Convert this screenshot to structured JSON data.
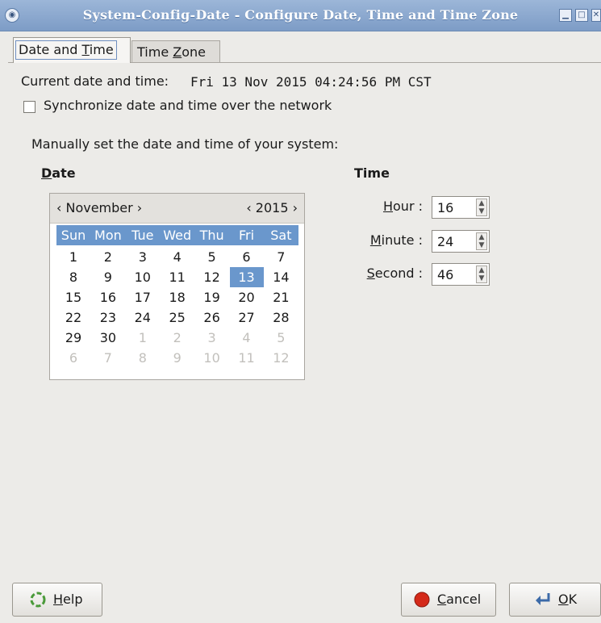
{
  "window": {
    "title": "System-Config-Date - Configure Date, Time and Time Zone"
  },
  "tabs": [
    {
      "label_pre": "Date and ",
      "mnemonic": "T",
      "label_post": "ime"
    },
    {
      "label_pre": "Time ",
      "mnemonic": "Z",
      "label_post": "one"
    }
  ],
  "current": {
    "label": "Current date and time:",
    "value": "Fri 13 Nov 2015 04:24:56 PM CST"
  },
  "sync": {
    "label": "Synchronize date and time over the network",
    "checked": false
  },
  "manual_label": "Manually set the date and time of your system:",
  "date_heading": {
    "mnemonic": "D",
    "rest": "ate"
  },
  "time_heading": "Time",
  "calendar": {
    "month": "‹ November ›",
    "year": "‹ 2015 ›",
    "day_names": [
      "Sun",
      "Mon",
      "Tue",
      "Wed",
      "Thu",
      "Fri",
      "Sat"
    ],
    "weeks": [
      [
        [
          "1",
          0
        ],
        [
          "2",
          0
        ],
        [
          "3",
          0
        ],
        [
          "4",
          0
        ],
        [
          "5",
          0
        ],
        [
          "6",
          0
        ],
        [
          "7",
          0
        ]
      ],
      [
        [
          "8",
          0
        ],
        [
          "9",
          0
        ],
        [
          "10",
          0
        ],
        [
          "11",
          0
        ],
        [
          "12",
          0
        ],
        [
          "13",
          2
        ],
        [
          "14",
          0
        ]
      ],
      [
        [
          "15",
          0
        ],
        [
          "16",
          0
        ],
        [
          "17",
          0
        ],
        [
          "18",
          0
        ],
        [
          "19",
          0
        ],
        [
          "20",
          0
        ],
        [
          "21",
          0
        ]
      ],
      [
        [
          "22",
          0
        ],
        [
          "23",
          0
        ],
        [
          "24",
          0
        ],
        [
          "25",
          0
        ],
        [
          "26",
          0
        ],
        [
          "27",
          0
        ],
        [
          "28",
          0
        ]
      ],
      [
        [
          "29",
          0
        ],
        [
          "30",
          0
        ],
        [
          "1",
          1
        ],
        [
          "2",
          1
        ],
        [
          "3",
          1
        ],
        [
          "4",
          1
        ],
        [
          "5",
          1
        ]
      ],
      [
        [
          "6",
          1
        ],
        [
          "7",
          1
        ],
        [
          "8",
          1
        ],
        [
          "9",
          1
        ],
        [
          "10",
          1
        ],
        [
          "11",
          1
        ],
        [
          "12",
          1
        ]
      ]
    ]
  },
  "time": {
    "hour": {
      "mnemonic": "H",
      "rest": "our :",
      "value": "16"
    },
    "minute": {
      "mnemonic": "M",
      "rest": "inute :",
      "value": "24"
    },
    "second": {
      "mnemonic": "S",
      "rest": "econd :",
      "value": "46"
    }
  },
  "buttons": {
    "help": {
      "mnemonic": "H",
      "rest": "elp"
    },
    "cancel": {
      "mnemonic": "C",
      "rest": "ancel"
    },
    "ok": {
      "mnemonic": "O",
      "rest": "K"
    }
  },
  "colors": {
    "selection": "#6a97cc",
    "titlebar": "#8aa8d0"
  }
}
